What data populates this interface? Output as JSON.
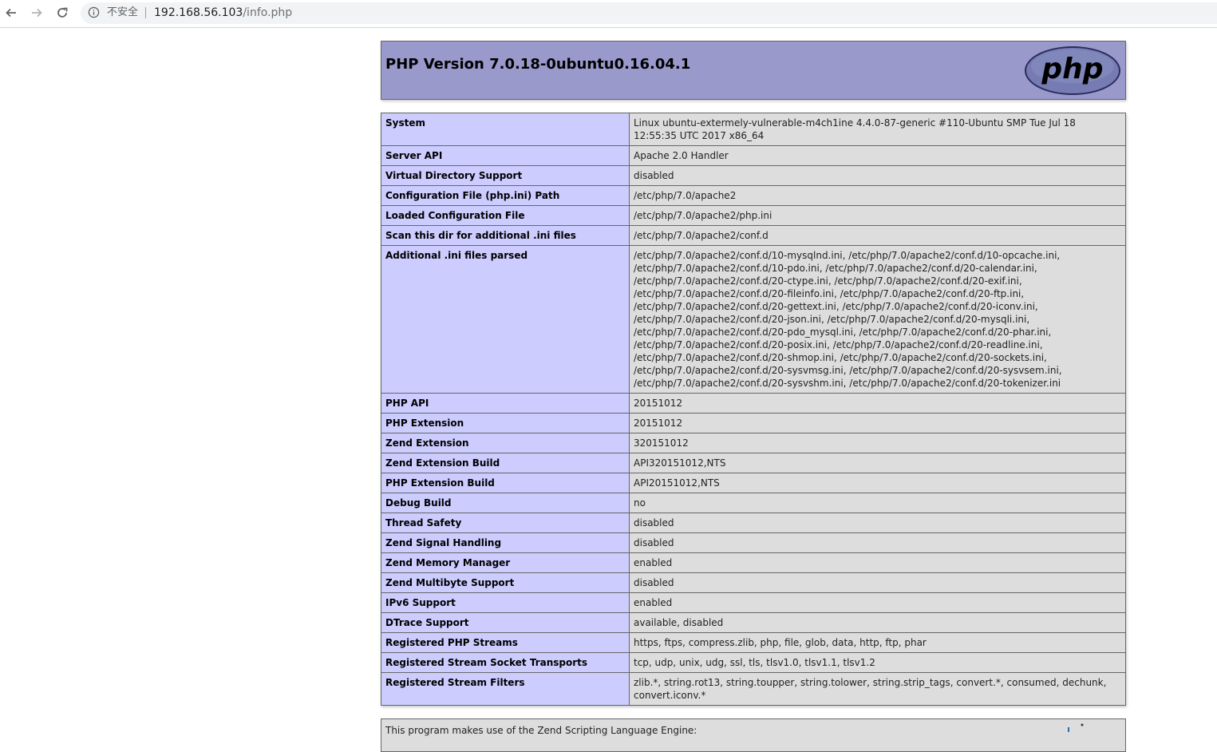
{
  "browser": {
    "security_label": "不安全",
    "url_host": "192.168.56.103",
    "url_path": "/info.php",
    "icons": [
      "back-arrow-icon",
      "forward-arrow-icon",
      "reload-icon",
      "info-icon"
    ]
  },
  "header": {
    "title": "PHP Version 7.0.18-0ubuntu0.16.04.1",
    "logo_text": "php"
  },
  "rows": [
    {
      "key": "System",
      "value": "Linux ubuntu-extermely-vulnerable-m4ch1ine 4.4.0-87-generic #110-Ubuntu SMP Tue Jul 18 12:55:35 UTC 2017 x86_64"
    },
    {
      "key": "Server API",
      "value": "Apache 2.0 Handler"
    },
    {
      "key": "Virtual Directory Support",
      "value": "disabled"
    },
    {
      "key": "Configuration File (php.ini) Path",
      "value": "/etc/php/7.0/apache2"
    },
    {
      "key": "Loaded Configuration File",
      "value": "/etc/php/7.0/apache2/php.ini"
    },
    {
      "key": "Scan this dir for additional .ini files",
      "value": "/etc/php/7.0/apache2/conf.d"
    },
    {
      "key": "Additional .ini files parsed",
      "lines": [
        "/etc/php/7.0/apache2/conf.d/10-mysqlnd.ini, /etc/php/7.0/apache2/conf.d/10-opcache.ini,",
        "/etc/php/7.0/apache2/conf.d/10-pdo.ini, /etc/php/7.0/apache2/conf.d/20-calendar.ini,",
        "/etc/php/7.0/apache2/conf.d/20-ctype.ini, /etc/php/7.0/apache2/conf.d/20-exif.ini,",
        "/etc/php/7.0/apache2/conf.d/20-fileinfo.ini, /etc/php/7.0/apache2/conf.d/20-ftp.ini,",
        "/etc/php/7.0/apache2/conf.d/20-gettext.ini, /etc/php/7.0/apache2/conf.d/20-iconv.ini,",
        "/etc/php/7.0/apache2/conf.d/20-json.ini, /etc/php/7.0/apache2/conf.d/20-mysqli.ini,",
        "/etc/php/7.0/apache2/conf.d/20-pdo_mysql.ini, /etc/php/7.0/apache2/conf.d/20-phar.ini,",
        "/etc/php/7.0/apache2/conf.d/20-posix.ini, /etc/php/7.0/apache2/conf.d/20-readline.ini,",
        "/etc/php/7.0/apache2/conf.d/20-shmop.ini, /etc/php/7.0/apache2/conf.d/20-sockets.ini,",
        "/etc/php/7.0/apache2/conf.d/20-sysvmsg.ini, /etc/php/7.0/apache2/conf.d/20-sysvsem.ini,",
        "/etc/php/7.0/apache2/conf.d/20-sysvshm.ini, /etc/php/7.0/apache2/conf.d/20-tokenizer.ini"
      ]
    },
    {
      "key": "PHP API",
      "value": "20151012"
    },
    {
      "key": "PHP Extension",
      "value": "20151012"
    },
    {
      "key": "Zend Extension",
      "value": "320151012"
    },
    {
      "key": "Zend Extension Build",
      "value": "API320151012,NTS"
    },
    {
      "key": "PHP Extension Build",
      "value": "API20151012,NTS"
    },
    {
      "key": "Debug Build",
      "value": "no"
    },
    {
      "key": "Thread Safety",
      "value": "disabled"
    },
    {
      "key": "Zend Signal Handling",
      "value": "disabled"
    },
    {
      "key": "Zend Memory Manager",
      "value": "enabled"
    },
    {
      "key": "Zend Multibyte Support",
      "value": "disabled"
    },
    {
      "key": "IPv6 Support",
      "value": "enabled"
    },
    {
      "key": "DTrace Support",
      "value": "available, disabled"
    },
    {
      "key": "Registered PHP Streams",
      "value": "https, ftps, compress.zlib, php, file, glob, data, http, ftp, phar"
    },
    {
      "key": "Registered Stream Socket Transports",
      "value": "tcp, udp, unix, udg, ssl, tls, tlsv1.0, tlsv1.1, tlsv1.2"
    },
    {
      "key": "Registered Stream Filters",
      "value": "zlib.*, string.rot13, string.toupper, string.tolower, string.strip_tags, convert.*, consumed, dechunk, convert.iconv.*"
    }
  ],
  "footer": {
    "text": "This program makes use of the Zend Scripting Language Engine:"
  },
  "colors": {
    "header_bg": "#9999cc",
    "key_bg": "#ccccff",
    "value_bg": "#dddddd",
    "border": "#666666"
  }
}
